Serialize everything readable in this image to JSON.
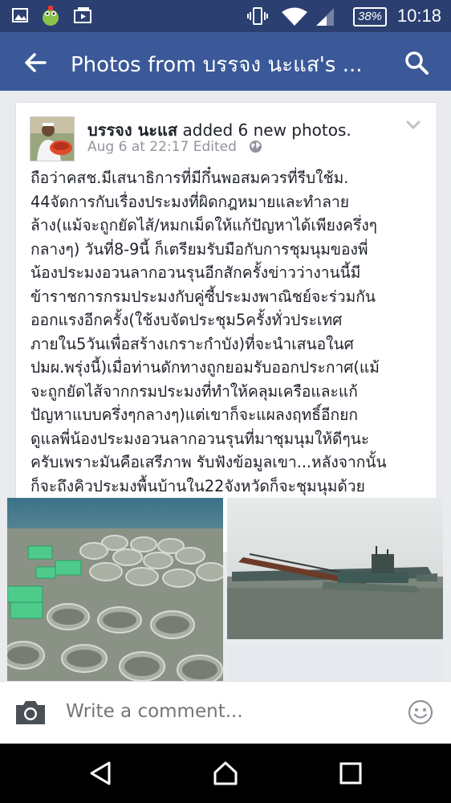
{
  "status_bar": {
    "battery": "38%",
    "time": "10:18"
  },
  "app_bar": {
    "title": "Photos from บรรจง นะแส's ..."
  },
  "post": {
    "author": "บรรจง นะแส",
    "action": " added 6 new photos.",
    "meta": "Aug 6 at 22:17 Edited",
    "text_lines": [
      "ถือว่าคสช.มีเสนาธิการที่มีกึ๋นพอสมควรที่รีบใช้ม.",
      "44จัดการกับเรื่องประมงที่ผิดกฎหมายและทำลาย",
      "ล้าง(แม้จะถูกยัดไส้/หมกเม็ดให้แก้ปัญหาได้เพียงครึ่งๆ",
      "กลางๆ) วันที่8-9นี้ ก็เตรียมรับมือกับการชุมนุมของพี่",
      "น้องประมงอวนลากอวนรุนอีกสักครั้งข่าวว่างานนี้มี",
      "ข้าราชการกรมประมงกับคู่ซี้ประมงพาณิชย์จะร่วมกัน",
      "ออกแรงอีกครั้ง(ใช้งบจัดประชุม5ครั้งทั่วประเทศ",
      "ภายใน5วันเพื่อสร้างเกราะกำบัง)ที่จะนำเสนอในศ",
      "ปมผ.พรุ่งนี้)เมื่อท่านดักทางถูกยอมรับออกประกาศ(แม้",
      "จะถูกยัดไส้จากกรมประมงที่ทำให้คลุมเครือและแก้",
      "ปัญหาแบบครึ่งๆกลางๆ)แต่เขาก็จะแผลงฤทธิ์อีกยก",
      "ดูแลพี่น้องประมงอวนลากอวนรุนที่มาชุมนุมให้ดีๆนะ",
      "ครับเพราะมันคือเสรีภาพ รับฟังข้อมูลเขา...หลังจากนั้น",
      "ก็จะถึงคิวประมงพื้นบ้านใน22จังหวัดก็จะชุมนุมด้วย"
    ]
  },
  "comment_bar": {
    "placeholder": "Write a comment..."
  },
  "icons": {
    "status_left": [
      "gallery-icon",
      "android-icon",
      "media-icon"
    ],
    "status_right": [
      "vibrate-icon",
      "wifi-icon",
      "signal-icon",
      "battery-icon"
    ],
    "app_bar": [
      "back-arrow-icon",
      "search-icon"
    ],
    "post": [
      "globe-icon",
      "chevron-down-icon"
    ],
    "comment_bar": [
      "camera-icon",
      "smiley-icon"
    ],
    "nav": [
      "back-nav-icon",
      "home-nav-icon",
      "recents-nav-icon"
    ]
  },
  "colors": {
    "facebook_blue": "#3b5998",
    "status_bar": "#2b3f70",
    "text": "#1d2129",
    "secondary_text": "#90949c"
  }
}
